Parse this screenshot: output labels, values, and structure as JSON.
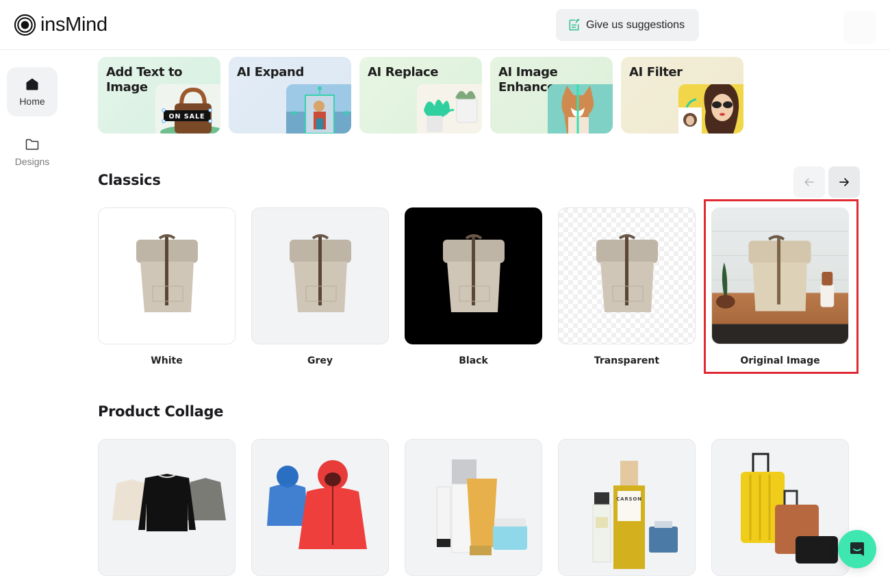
{
  "header": {
    "brand": "insMind",
    "suggest_label": "Give us suggestions"
  },
  "sidebar": {
    "items": [
      {
        "label": "Home",
        "icon": "home-icon",
        "active": true
      },
      {
        "label": "Designs",
        "icon": "folder-icon",
        "active": false
      }
    ]
  },
  "features": [
    {
      "title": "Add Text to Image",
      "badge": "ON SALE"
    },
    {
      "title": "AI Expand"
    },
    {
      "title": "AI Replace"
    },
    {
      "title": "AI Image Enhancer"
    },
    {
      "title": "AI Filter"
    }
  ],
  "classics": {
    "title": "Classics",
    "prev_icon": "arrow-left-icon",
    "next_icon": "arrow-right-icon",
    "items": [
      {
        "label": "White"
      },
      {
        "label": "Grey"
      },
      {
        "label": "Black"
      },
      {
        "label": "Transparent"
      },
      {
        "label": "Original Image",
        "highlighted": true
      }
    ]
  },
  "collage": {
    "title": "Product Collage",
    "items": [
      {
        "name": "sweaters"
      },
      {
        "name": "puffer-jackets"
      },
      {
        "name": "cosmetics"
      },
      {
        "name": "perfumes",
        "label_text": "CARSON"
      },
      {
        "name": "luggage"
      }
    ]
  },
  "colors": {
    "accent": "#3ee6b0",
    "highlight": "#e02a32"
  }
}
